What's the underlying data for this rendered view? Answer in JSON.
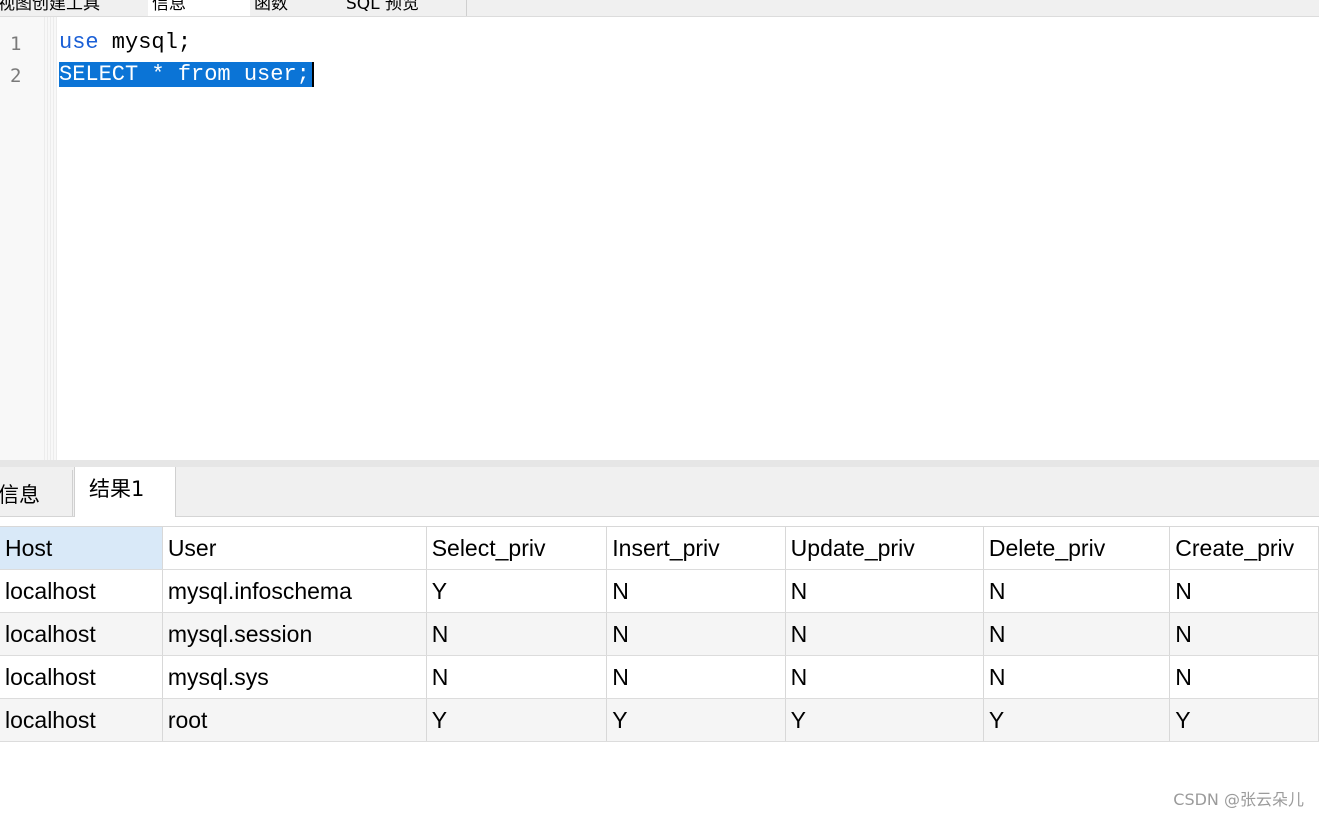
{
  "top_tabs": [
    {
      "label": "视图创建工具",
      "active": false
    },
    {
      "label": "信息",
      "active": true
    },
    {
      "label": "函数",
      "active": false
    },
    {
      "label": "SQL 预览",
      "active": false
    }
  ],
  "editor": {
    "lines": [
      {
        "number": "1",
        "keyword": "use",
        "rest": " mysql;"
      },
      {
        "number": "2",
        "selected_text": "SELECT * from user;"
      }
    ]
  },
  "result_tabs": {
    "info_label": "信息",
    "result_label": "结果1"
  },
  "table": {
    "columns": [
      "Host",
      "User",
      "Select_priv",
      "Insert_priv",
      "Update_priv",
      "Delete_priv",
      "Create_priv"
    ],
    "rows": [
      [
        "localhost",
        "mysql.infoschema",
        "Y",
        "N",
        "N",
        "N",
        "N"
      ],
      [
        "localhost",
        "mysql.session",
        "N",
        "N",
        "N",
        "N",
        "N"
      ],
      [
        "localhost",
        "mysql.sys",
        "N",
        "N",
        "N",
        "N",
        "N"
      ],
      [
        "localhost",
        "root",
        "Y",
        "Y",
        "Y",
        "Y",
        "Y"
      ]
    ]
  },
  "watermark": "CSDN @张云朵儿",
  "colors": {
    "keyword": "#1a5fd6",
    "selection": "#0b74d6",
    "sorted_header": "#d9e9f8"
  }
}
